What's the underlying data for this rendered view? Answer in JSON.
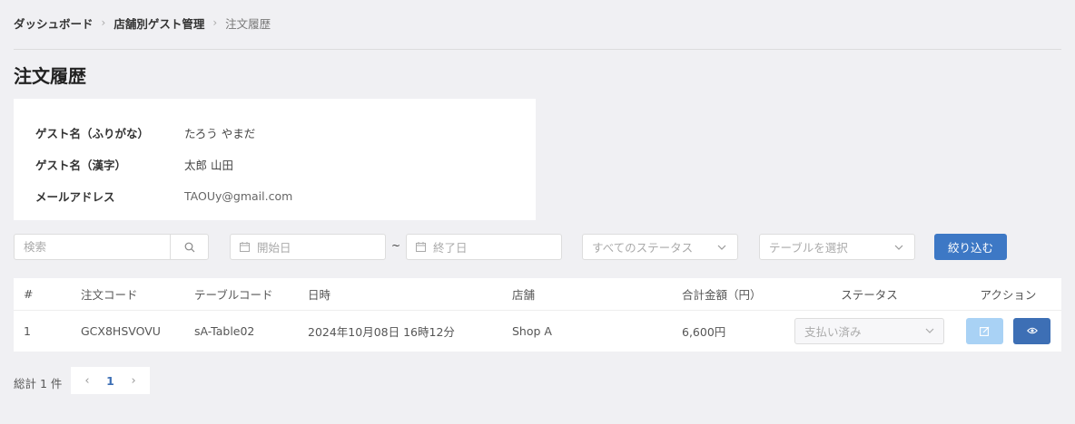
{
  "breadcrumb": {
    "items": [
      "ダッシュボード",
      "店舗別ゲスト管理",
      "注文履歴"
    ],
    "separator": "›"
  },
  "page_title": "注文履歴",
  "guest": {
    "kana_label": "ゲスト名（ふりがな）",
    "kana_value": "たろう やまだ",
    "kanji_label": "ゲスト名（漢字）",
    "kanji_value": "太郎 山田",
    "email_label": "メールアドレス",
    "email_value": "TAOUy@gmail.com"
  },
  "filters": {
    "search_placeholder": "検索",
    "start_date_placeholder": "開始日",
    "range_separator": "~",
    "end_date_placeholder": "終了日",
    "status_placeholder": "すべてのステータス",
    "table_placeholder": "テーブルを選択",
    "filter_button": "絞り込む"
  },
  "table": {
    "headers": {
      "index": "#",
      "order_code": "注文コード",
      "table_code": "テーブルコード",
      "datetime": "日時",
      "store": "店舗",
      "total": "合計金額（円）",
      "status": "ステータス",
      "action": "アクション"
    },
    "rows": [
      {
        "index": "1",
        "order_code": "GCX8HSVOVU",
        "table_code": "sA-Table02",
        "datetime": "2024年10月08日 16時12分",
        "store": "Shop A",
        "total": "6,600円",
        "status": "支払い済み"
      }
    ]
  },
  "pagination": {
    "total": "総計 1 件",
    "current_page": "1",
    "prev": "‹",
    "next": "›"
  },
  "colors": {
    "primary": "#3d78c5",
    "view_button": "#3d6fb5",
    "edit_button": "#a9d2f5",
    "background": "#f0f0f3"
  },
  "icons": {
    "search": "search-icon",
    "calendar": "calendar-icon",
    "chevron": "chevron-down-icon",
    "edit": "edit-icon",
    "view": "eye-icon"
  }
}
